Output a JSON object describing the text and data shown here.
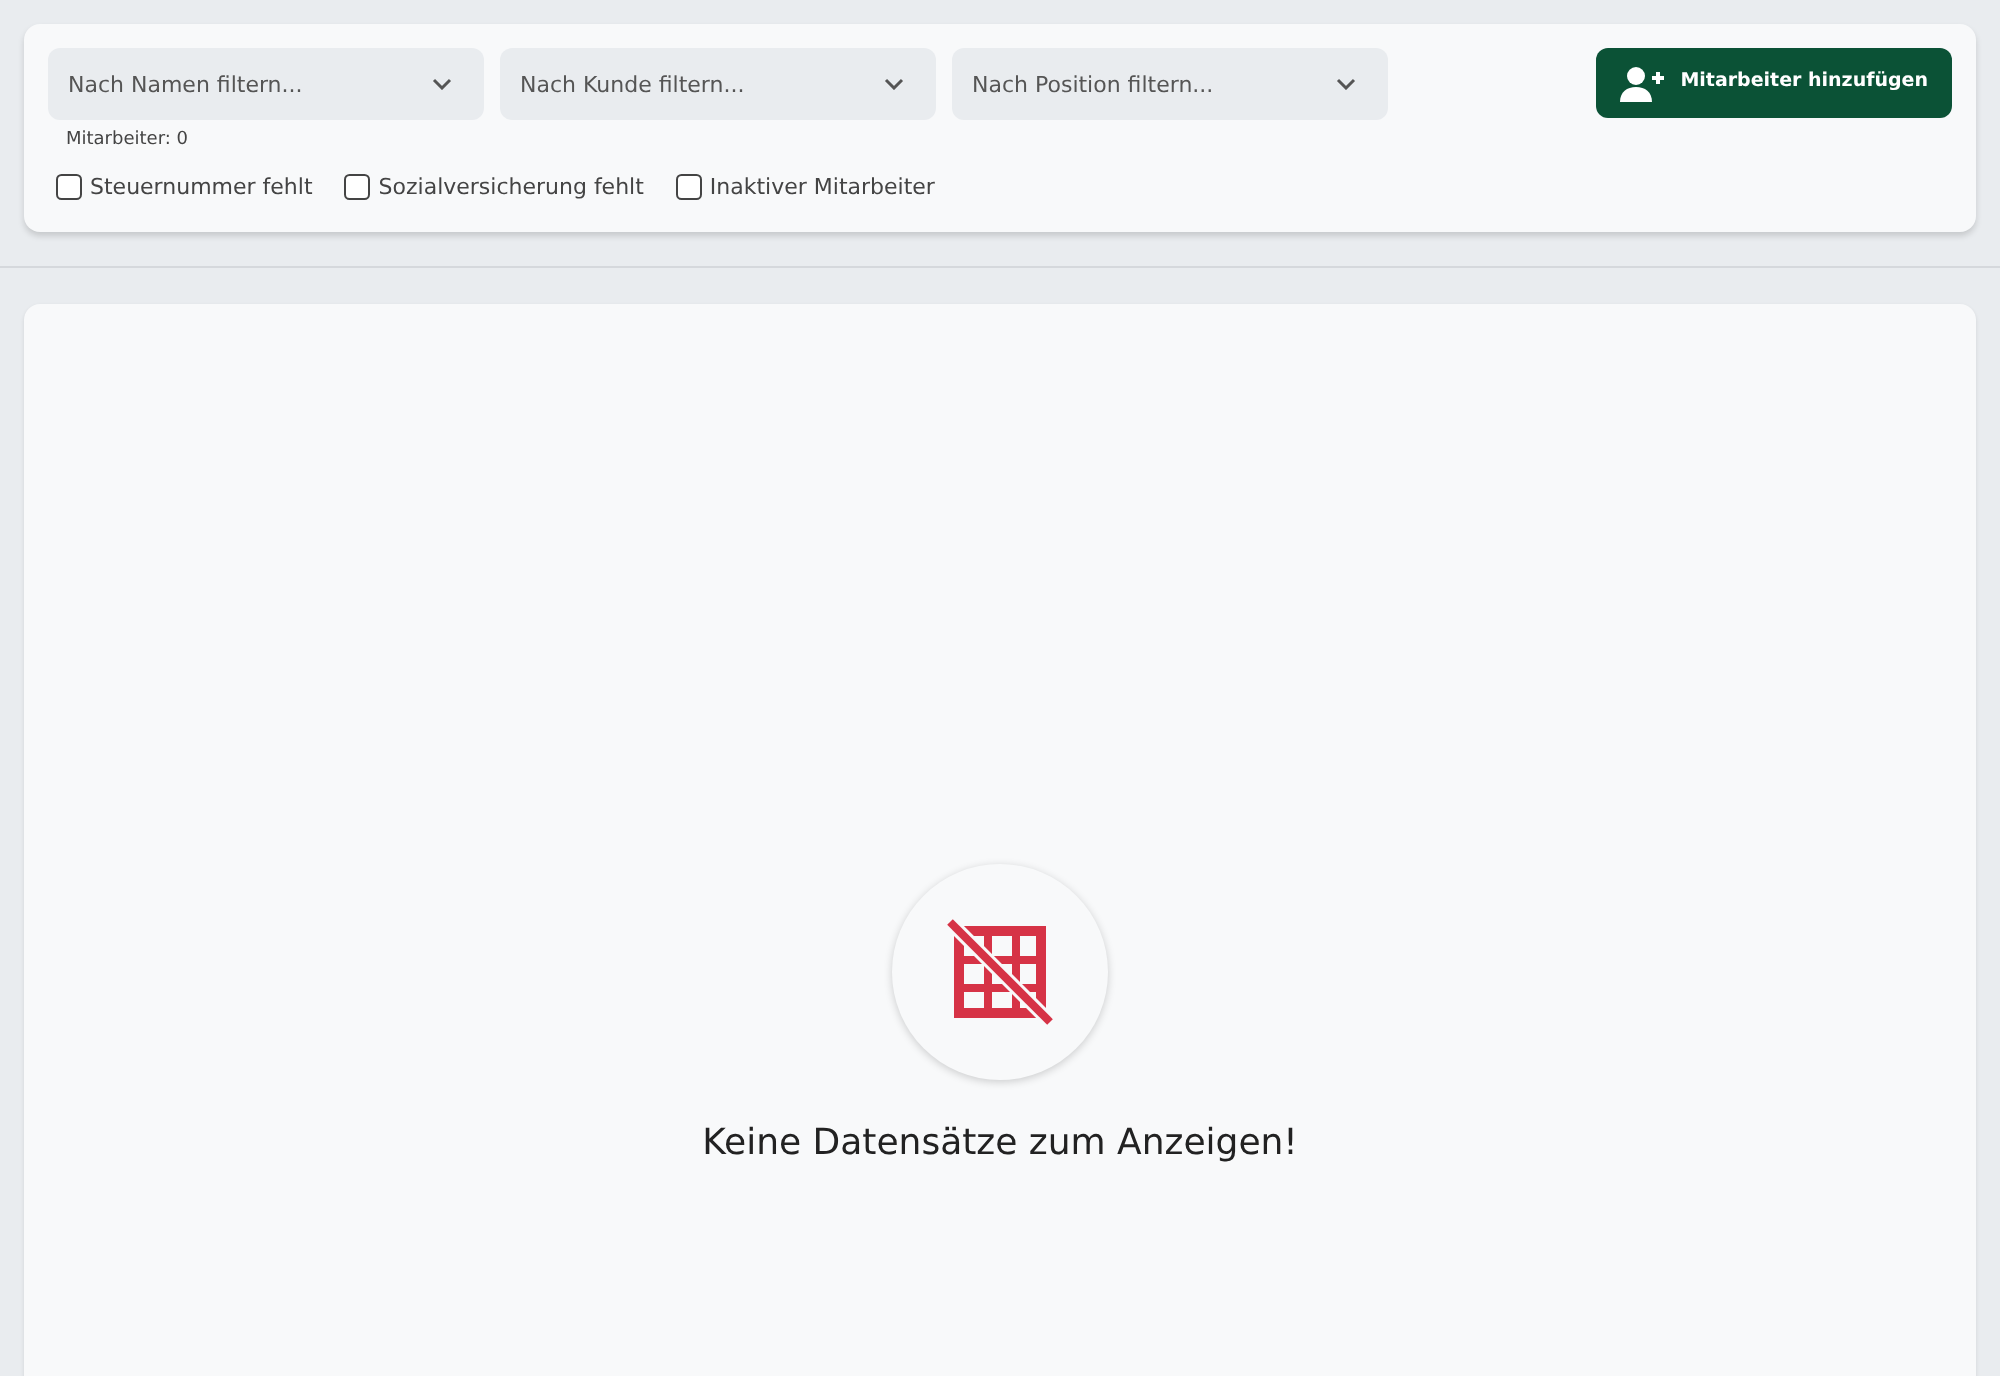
{
  "filters": [
    {
      "placeholder": "Nach Namen filtern..."
    },
    {
      "placeholder": "Nach Kunde filtern..."
    },
    {
      "placeholder": "Nach Position filtern..."
    }
  ],
  "add_button": {
    "label": "Mitarbeiter hinzufügen"
  },
  "count": {
    "label": "Mitarbeiter:",
    "value": "0"
  },
  "checkboxes": [
    {
      "label": "Steuernummer fehlt",
      "checked": false
    },
    {
      "label": "Sozialversicherung fehlt",
      "checked": false
    },
    {
      "label": "Inaktiver Mitarbeiter",
      "checked": false
    }
  ],
  "empty_state": {
    "message": "Keine Datensätze zum Anzeigen!"
  }
}
